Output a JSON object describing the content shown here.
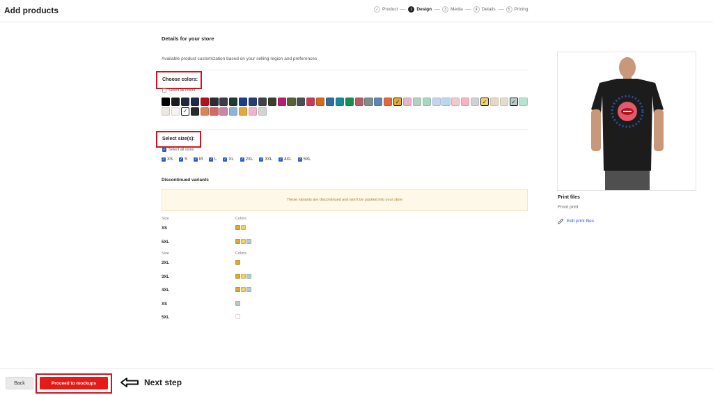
{
  "header": {
    "title": "Add products",
    "steps": [
      {
        "badge": "✓",
        "label": "Product",
        "state": "done"
      },
      {
        "badge": "2",
        "label": "Design",
        "state": "active"
      },
      {
        "badge": "3",
        "label": "Media",
        "state": "todo"
      },
      {
        "badge": "4",
        "label": "Details",
        "state": "todo"
      },
      {
        "badge": "5",
        "label": "Pricing",
        "state": "todo"
      }
    ]
  },
  "main": {
    "section_title": "Details for your store",
    "subtitle": "Available product customization based on your selling region and preferences",
    "colors": {
      "label": "Choose colors:",
      "select_all": "Select all colors",
      "select_all_checked": false,
      "swatches": [
        {
          "hex": "#000000",
          "selected": false
        },
        {
          "hex": "#1b1b1b",
          "selected": false
        },
        {
          "hex": "#232a3d",
          "selected": false
        },
        {
          "hex": "#1d2b4a",
          "selected": false
        },
        {
          "hex": "#b3121d",
          "selected": false
        },
        {
          "hex": "#2c2f36",
          "selected": false
        },
        {
          "hex": "#3a3d44",
          "selected": false
        },
        {
          "hex": "#1f3b2e",
          "selected": false
        },
        {
          "hex": "#1c3f8c",
          "selected": false
        },
        {
          "hex": "#263f6f",
          "selected": false
        },
        {
          "hex": "#3f4248",
          "selected": false
        },
        {
          "hex": "#3b3f2e",
          "selected": false
        },
        {
          "hex": "#b51f6f",
          "selected": false
        },
        {
          "hex": "#5b6136",
          "selected": false
        },
        {
          "hex": "#4a4e55",
          "selected": false
        },
        {
          "hex": "#c73a5a",
          "selected": false
        },
        {
          "hex": "#d06a1f",
          "selected": false
        },
        {
          "hex": "#2f6ea0",
          "selected": false
        },
        {
          "hex": "#178a99",
          "selected": false
        },
        {
          "hex": "#1c8c52",
          "selected": false
        },
        {
          "hex": "#b65c6a",
          "selected": false
        },
        {
          "hex": "#7c8f8a",
          "selected": false
        },
        {
          "hex": "#5f86b3",
          "selected": false
        },
        {
          "hex": "#e2673a",
          "selected": false
        },
        {
          "hex": "#e2aa2a",
          "selected": true
        },
        {
          "hex": "#e9b3c9",
          "selected": false
        },
        {
          "hex": "#b6cfc2",
          "selected": false
        },
        {
          "hex": "#a9d7c4",
          "selected": false
        },
        {
          "hex": "#c7d3ee",
          "selected": false
        },
        {
          "hex": "#b9d7ef",
          "selected": false
        },
        {
          "hex": "#f2c8cf",
          "selected": false
        },
        {
          "hex": "#f4b4c3",
          "selected": false
        },
        {
          "hex": "#cfd3d6",
          "selected": false
        },
        {
          "hex": "#f0d26a",
          "selected": true
        },
        {
          "hex": "#e6d8c4",
          "selected": false
        },
        {
          "hex": "#e3ddd0",
          "selected": false
        },
        {
          "hex": "#b7ccc8",
          "selected": true
        },
        {
          "hex": "#b7e3d2",
          "selected": false
        },
        {
          "hex": "#ebe6de",
          "selected": false
        },
        {
          "hex": "#f3f3f3",
          "selected": false
        },
        {
          "hex": "#ffffff",
          "selected": true
        },
        {
          "hex": "#2a2a2a",
          "selected": false
        },
        {
          "hex": "#d9855a",
          "selected": false
        },
        {
          "hex": "#d36a6a",
          "selected": false
        },
        {
          "hex": "#c986aa",
          "selected": false
        },
        {
          "hex": "#8fb2d8",
          "selected": false
        },
        {
          "hex": "#e0a93a",
          "selected": false
        },
        {
          "hex": "#efb6cb",
          "selected": false
        },
        {
          "hex": "#d3d3d3",
          "selected": false
        }
      ]
    },
    "sizes": {
      "label": "Select size(s):",
      "select_all": "Select all sizes",
      "select_all_checked": true,
      "items": [
        {
          "label": "XS",
          "checked": true
        },
        {
          "label": "S",
          "checked": true
        },
        {
          "label": "M",
          "checked": true
        },
        {
          "label": "L",
          "checked": true
        },
        {
          "label": "XL",
          "checked": true
        },
        {
          "label": "2XL",
          "checked": true
        },
        {
          "label": "3XL",
          "checked": true
        },
        {
          "label": "4XL",
          "checked": true
        },
        {
          "label": "5XL",
          "checked": true
        }
      ]
    },
    "discontinued": {
      "title": "Discontinued variants",
      "banner": "These variants are discontinued and won't be pushed into your store",
      "group1": {
        "size_header": "Size",
        "colors_header": "Colors",
        "rows": [
          {
            "size": "XS",
            "colors": [
              "#e2aa2a",
              "#f0d26a"
            ]
          },
          {
            "size": "5XL",
            "colors": [
              "#e2aa2a",
              "#f0d26a",
              "#b7ccc8"
            ]
          }
        ]
      },
      "group2": {
        "size_header": "Size",
        "colors_header": "Colors",
        "rows": [
          {
            "size": "2XL",
            "colors": [
              "#e2aa2a"
            ]
          },
          {
            "size": "3XL",
            "colors": [
              "#e2aa2a",
              "#f0d26a",
              "#b7ccc8"
            ]
          },
          {
            "size": "4XL",
            "colors": [
              "#e2aa2a",
              "#f0d26a",
              "#b7ccc8"
            ]
          },
          {
            "size": "XS",
            "colors": [
              "#b7ccc8"
            ]
          },
          {
            "size": "5XL",
            "colors": [
              "#ffffff"
            ]
          }
        ]
      }
    }
  },
  "sidebar": {
    "print_files_title": "Print files",
    "front_print": "Front print",
    "edit_label": "Edit print files"
  },
  "footer": {
    "back_label": "Back",
    "proceed_label": "Proceed to mockups",
    "annotation": "Next step"
  }
}
